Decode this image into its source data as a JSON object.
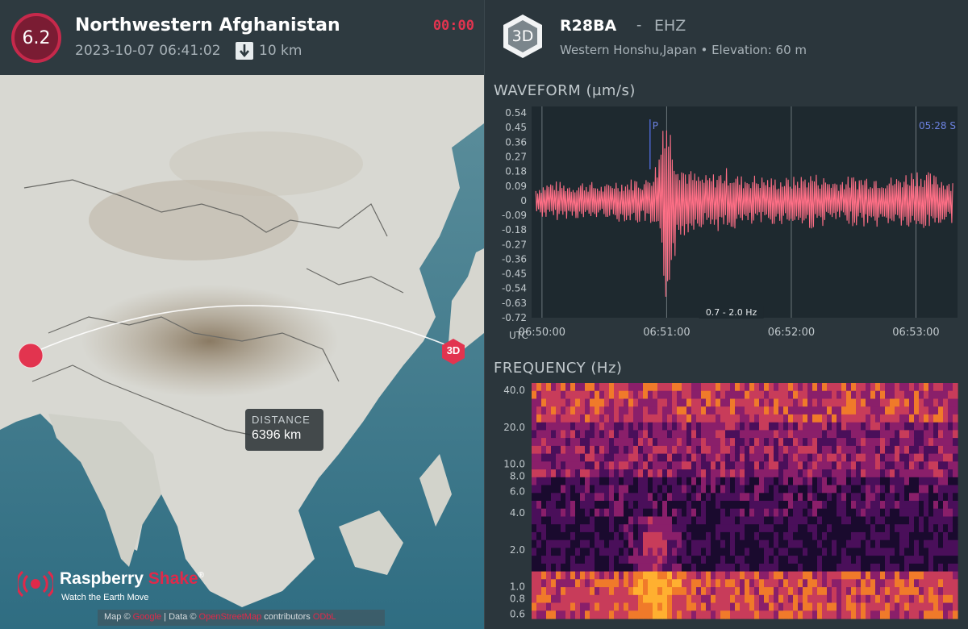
{
  "event": {
    "magnitude": "6.2",
    "title": "Northwestern Afghanistan",
    "datetime": "2023-10-07 06:41:02",
    "depth": "10 km",
    "timer": "00:00",
    "colors": {
      "magnitude_ring": "#c6294b",
      "magnitude_fill": "#7a1c33",
      "timer": "#e2344f"
    }
  },
  "map": {
    "distance_label": "DISTANCE",
    "distance_value": "6396 km",
    "station_marker_label": "3D",
    "brand_name_part1": "Raspberry",
    "brand_name_part2": "Shake",
    "brand_reg": "®",
    "brand_tagline": "Watch the Earth Move",
    "attribution_prefix": "Map ©",
    "attribution_link1": "Google",
    "attribution_mid": "| Data ©",
    "attribution_link2": "OpenStreetMap",
    "attribution_suffix": "contributors",
    "attribution_link3": "ODbL",
    "colors": {
      "epicenter": "#e2344f",
      "station": "#e2344f",
      "path": "#ffffff"
    }
  },
  "station": {
    "badge": "3D",
    "code": "R28BA",
    "separator": "-",
    "channel": "EHZ",
    "location": "Western Honshu,Japan • Elevation: 60 m"
  },
  "waveform": {
    "title": "WAVEFORM (µm/s)",
    "filter_label": "0.7 - 2.0 Hz",
    "p_marker": "P",
    "s_marker": "05:28  S",
    "utc_label": "UTC",
    "colors": {
      "trace": "#ff6f86",
      "background": "#1e292f",
      "marker": "#4a63c9"
    }
  },
  "frequency": {
    "title": "FREQUENCY (Hz)"
  },
  "chart_data": [
    {
      "type": "line",
      "name": "waveform",
      "ylabel": "WAVEFORM (µm/s)",
      "y_ticks": [
        "0.54",
        "0.45",
        "0.36",
        "0.27",
        "0.18",
        "0.09",
        "0",
        "-0.09",
        "-0.18",
        "-0.27",
        "-0.36",
        "-0.45",
        "-0.54",
        "-0.63",
        "-0.72"
      ],
      "ylim": [
        -0.72,
        0.58
      ],
      "x_ticks": [
        "06:50:00",
        "06:51:00",
        "06:52:00",
        "06:53:00"
      ],
      "x_tick_times": [
        0,
        60,
        120,
        180
      ],
      "xlim": [
        -5,
        200
      ],
      "p_arrival_time": 52,
      "s_arrival_time": 180,
      "series": [
        {
          "x": [
            -3,
            0,
            5,
            10,
            15,
            20,
            25,
            30,
            35,
            40,
            45,
            50,
            52,
            54,
            56,
            57,
            58,
            59,
            60,
            61,
            62,
            63,
            64,
            65,
            66,
            68,
            70,
            72,
            75,
            80,
            85,
            90,
            95,
            100,
            110,
            120,
            130,
            140,
            150,
            160,
            170,
            180,
            190,
            198
          ],
          "y": [
            0.08,
            -0.1,
            0.12,
            -0.11,
            0.1,
            -0.12,
            0.11,
            -0.09,
            0.13,
            -0.12,
            0.14,
            -0.13,
            0.18,
            -0.2,
            0.28,
            -0.35,
            0.55,
            -0.72,
            0.6,
            -0.5,
            0.45,
            -0.4,
            0.35,
            -0.3,
            0.28,
            -0.22,
            0.2,
            -0.18,
            0.16,
            -0.15,
            0.18,
            -0.2,
            0.15,
            -0.16,
            0.14,
            -0.14,
            0.17,
            -0.13,
            0.15,
            -0.16,
            0.14,
            -0.2,
            0.15,
            -0.13
          ]
        }
      ]
    },
    {
      "type": "heatmap",
      "name": "spectrogram",
      "ylabel": "FREQUENCY (Hz)",
      "y_ticks": [
        "40.0",
        "20.0",
        "10.0",
        "8.0",
        "6.0",
        "4.0",
        "2.0",
        "1.0",
        "0.8",
        "0.6"
      ],
      "y_tick_values": [
        40,
        20,
        10,
        8,
        6,
        4,
        2,
        1,
        0.8,
        0.6
      ],
      "ylim": [
        0.55,
        46
      ],
      "y_scale": "log",
      "colormap": [
        "#1a0a2e",
        "#4a0f5a",
        "#8a1f6a",
        "#c83c5a",
        "#f07a2a",
        "#ffb030"
      ]
    }
  ]
}
